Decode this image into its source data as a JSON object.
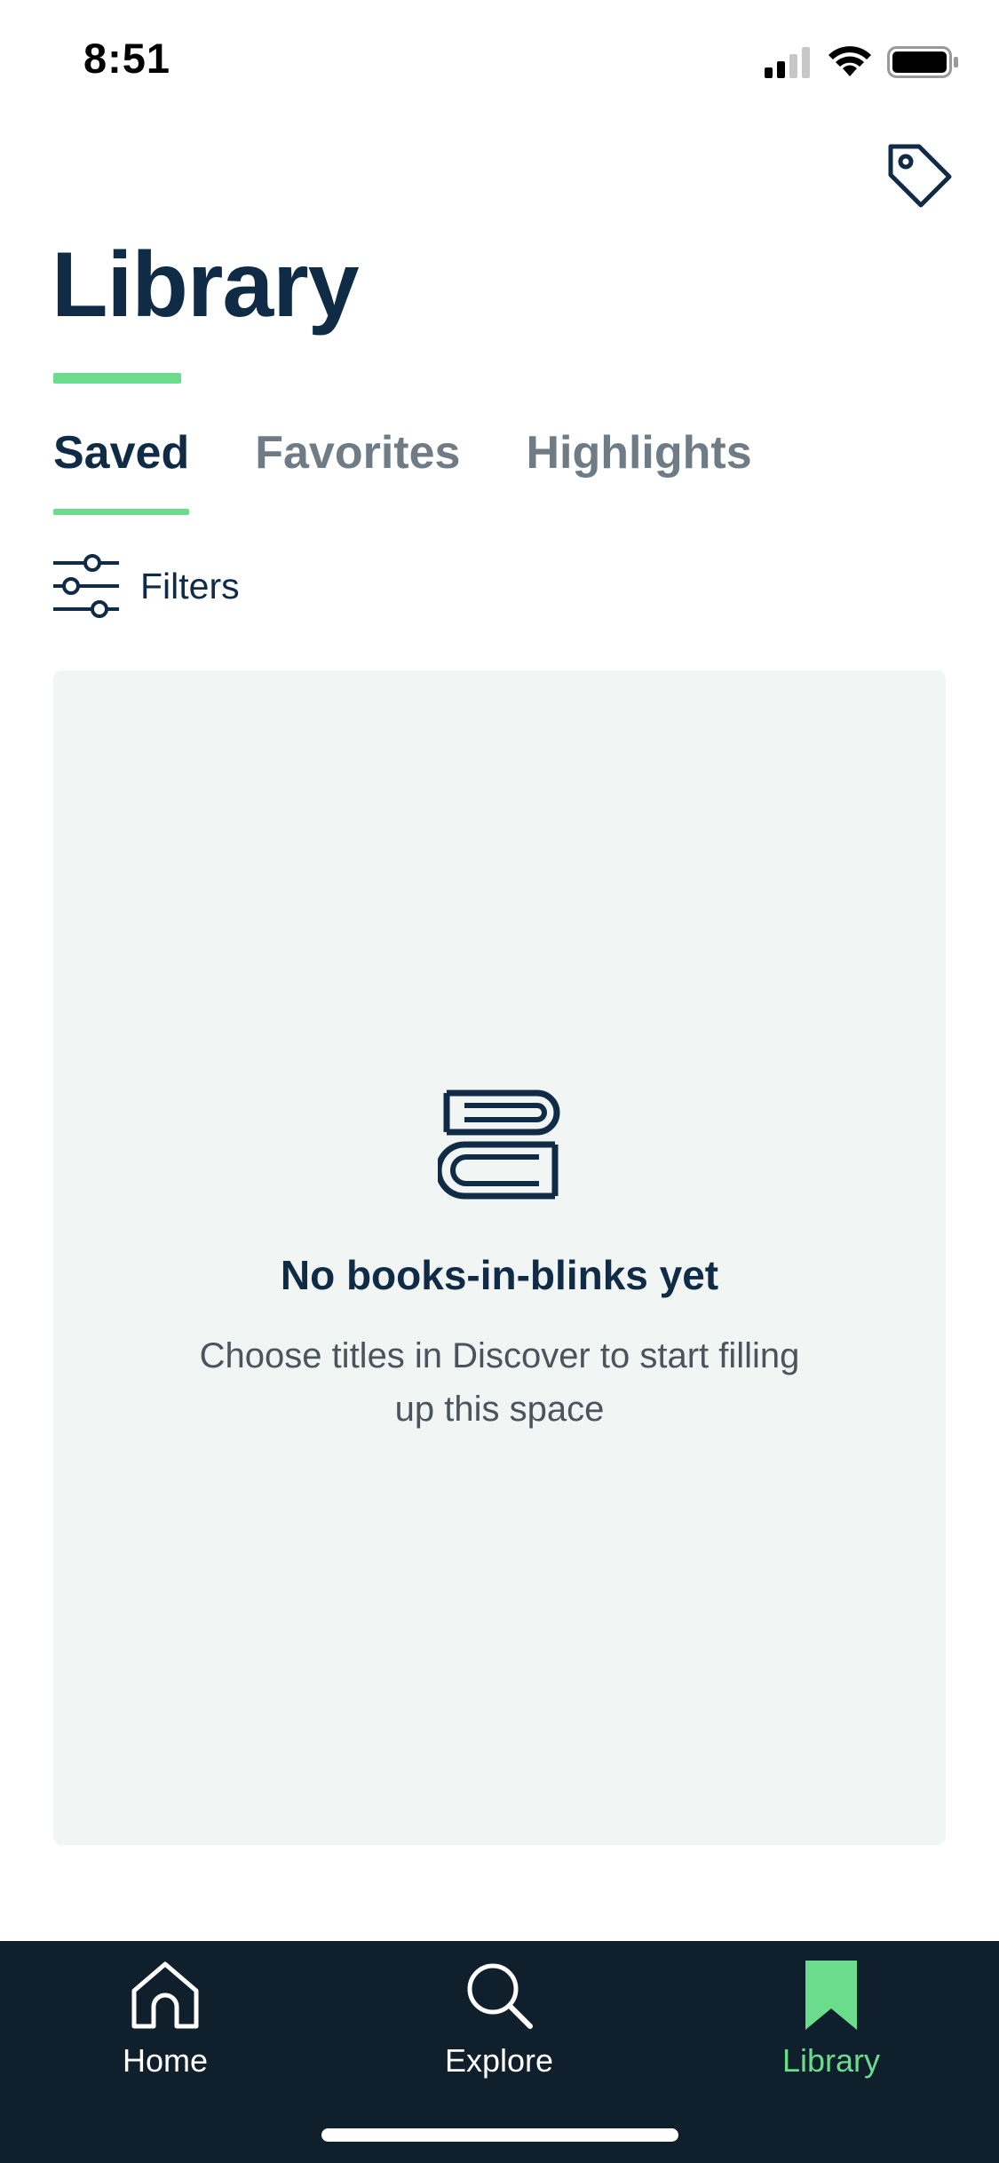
{
  "status_bar": {
    "time": "8:51"
  },
  "header": {
    "title": "Library",
    "tag_icon": "tag-icon"
  },
  "tabs": [
    {
      "label": "Saved",
      "active": true
    },
    {
      "label": "Favorites",
      "active": false
    },
    {
      "label": "Highlights",
      "active": false
    }
  ],
  "filters": {
    "label": "Filters",
    "icon": "sliders-icon"
  },
  "empty_state": {
    "icon": "books-stack-icon",
    "title": "No books-in-blinks yet",
    "subtitle": "Choose titles in Discover to start filling up this space"
  },
  "tab_bar": {
    "items": [
      {
        "label": "Home",
        "icon": "home-icon",
        "active": false
      },
      {
        "label": "Explore",
        "icon": "search-icon",
        "active": false
      },
      {
        "label": "Library",
        "icon": "bookmark-icon",
        "active": true
      }
    ]
  },
  "colors": {
    "primary_text": "#0f2b46",
    "accent": "#6bdc8c",
    "card_background": "#f1f5f4",
    "tab_bar_background": "#0f1f2c",
    "inactive_tab": "#6f7b85"
  }
}
